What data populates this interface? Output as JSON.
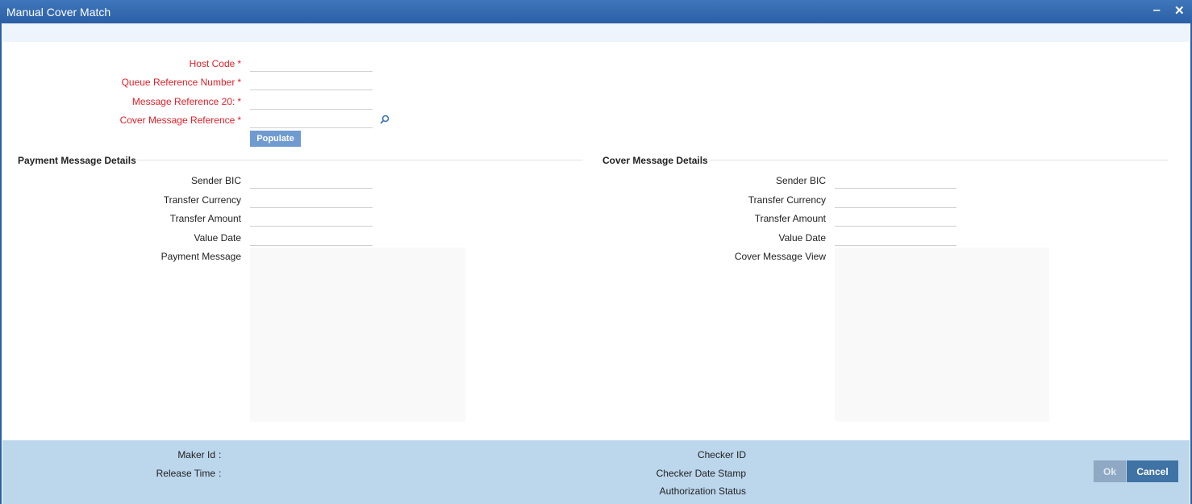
{
  "window": {
    "title": "Manual Cover Match",
    "minimize_symbol": "‒",
    "close_symbol": "✕"
  },
  "header_fields": [
    {
      "label": "Host Code",
      "value": ""
    },
    {
      "label": "Queue Reference Number",
      "value": ""
    },
    {
      "label": "Message Reference 20:",
      "value": ""
    },
    {
      "label": "Cover Message Reference",
      "value": ""
    }
  ],
  "required_marker": "*",
  "populate_label": "Populate",
  "payment": {
    "title": "Payment Message Details",
    "sender_bic": "Sender BIC",
    "transfer_currency": "Transfer Currency",
    "transfer_amount": "Transfer Amount",
    "value_date": "Value Date",
    "message": "Payment Message"
  },
  "cover": {
    "title": "Cover Message Details",
    "sender_bic": "Sender BIC",
    "transfer_currency": "Transfer Currency",
    "transfer_amount": "Transfer Amount",
    "value_date": "Value Date",
    "message": "Cover Message View"
  },
  "footer": {
    "maker_id": "Maker Id",
    "release_time": "Release Time",
    "colon": ":",
    "checker_id": "Checker ID",
    "checker_date_stamp": "Checker Date Stamp",
    "authorization_status": "Authorization Status",
    "ok_label": "Ok",
    "cancel_label": "Cancel"
  },
  "colors": {
    "title_bar": "#2b5fa6",
    "required_label": "#e0202a",
    "footer_bg": "#bcd6ec",
    "cancel_button": "#3f73a5"
  }
}
